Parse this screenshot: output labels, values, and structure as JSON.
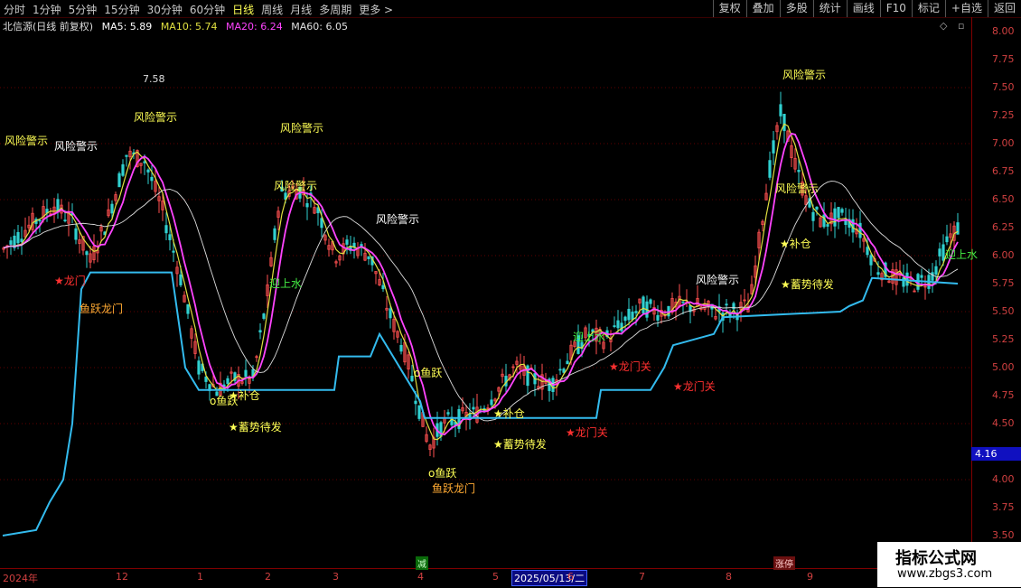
{
  "toolbar": {
    "periods": [
      "分时",
      "1分钟",
      "5分钟",
      "15分钟",
      "30分钟",
      "60分钟",
      "日线",
      "周线",
      "月线",
      "多周期",
      "更多 >"
    ],
    "active_period": "日线",
    "right_buttons": [
      "复权",
      "叠加",
      "多股",
      "统计",
      "画线",
      "F10",
      "标记",
      "+自选",
      "返回"
    ]
  },
  "info": {
    "stock": "北信源(日线 前复权)",
    "ma5": "MA5: 5.89",
    "ma10": "MA10: 5.74",
    "ma20": "MA20: 6.24",
    "ma60": "MA60: 6.05"
  },
  "colors": {
    "ma5": "#ffffff",
    "ma10": "#e0e040",
    "ma20": "#ff44ff",
    "ma60": "#e0e0e0",
    "support": "#33bbee",
    "warning": "#ffff55",
    "buy": "#ff4040",
    "fish": "#ffdd55"
  },
  "y_axis": {
    "ticks": [
      "8.00",
      "7.75",
      "7.50",
      "7.25",
      "7.00",
      "6.75",
      "6.50",
      "6.25",
      "6.00",
      "5.75",
      "5.50",
      "5.25",
      "5.00",
      "4.75",
      "4.50",
      "4.25",
      "4.00",
      "3.75",
      "3.50"
    ],
    "current_price": "4.16"
  },
  "x_axis": {
    "labels": [
      "2024年",
      "12",
      "1",
      "2",
      "3",
      "4",
      "5",
      "6",
      "7",
      "8",
      "9"
    ],
    "cursor_date": "2025/05/13/二"
  },
  "peak_label": "7.58",
  "annotations": [
    {
      "text": "风险警示",
      "color": "yellow"
    },
    {
      "text": "风险警示",
      "color": "white"
    },
    {
      "text": "风险警示",
      "color": "yellow"
    },
    {
      "text": "风险警示",
      "color": "yellow"
    },
    {
      "text": "风险警示",
      "color": "yellow"
    },
    {
      "text": "风险警示",
      "color": "white"
    },
    {
      "text": "风险警示",
      "color": "white"
    },
    {
      "text": "风险警示",
      "color": "yellow"
    },
    {
      "text": "风险警示",
      "color": "yellow"
    },
    {
      "text": "★龙门",
      "color": "red"
    },
    {
      "text": "鱼跃龙门",
      "color": "orange"
    },
    {
      "text": "o鱼跃",
      "color": "yellow"
    },
    {
      "text": "★补仓",
      "color": "yellow"
    },
    {
      "text": "★蓄势待发",
      "color": "yellow"
    },
    {
      "text": "迎上水",
      "color": "green"
    },
    {
      "text": "o鱼跃",
      "color": "yellow"
    },
    {
      "text": "o鱼跃",
      "color": "yellow"
    },
    {
      "text": "鱼跃龙门",
      "color": "orange"
    },
    {
      "text": "★补仓",
      "color": "yellow"
    },
    {
      "text": "★蓄势待发",
      "color": "yellow"
    },
    {
      "text": "★龙门关",
      "color": "red"
    },
    {
      "text": "迎上水",
      "color": "green"
    },
    {
      "text": "★龙门关",
      "color": "red"
    },
    {
      "text": "★龙门关",
      "color": "red"
    },
    {
      "text": "★补仓",
      "color": "yellow"
    },
    {
      "text": "★蓄势待发",
      "color": "yellow"
    },
    {
      "text": "迎上水",
      "color": "green"
    }
  ],
  "events": {
    "jian": "减",
    "zhangting": "涨停"
  },
  "watermark": {
    "title": "指标公式网",
    "url": "www.zbgs3.com"
  }
}
